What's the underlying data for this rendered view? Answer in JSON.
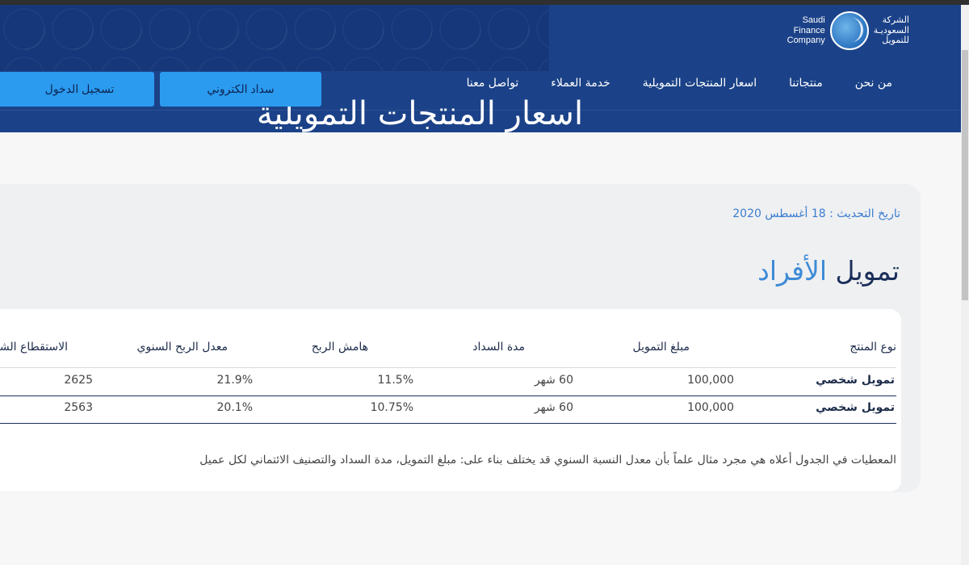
{
  "logo": {
    "en_lines": [
      "Saudi",
      "Finance",
      "Company"
    ],
    "ar_lines": [
      "الشركة",
      "السعوديـة",
      "للتمويل"
    ]
  },
  "nav": {
    "items": [
      "من نحن",
      "منتجاتنا",
      "اسعار المنتجات التمويلية",
      "خدمة العملاء",
      "تواصل معنا"
    ]
  },
  "buttons": {
    "pay": "سداد الكتروني",
    "login": "تسجيل الدخول"
  },
  "hero": {
    "title_behind": "اسعار المنتجات التمويلية"
  },
  "page": {
    "update_date": "تاريخ التحديث : 18 أغسطس 2020",
    "section_title_part1": "تمويل",
    "section_title_part2": "الأفراد"
  },
  "table": {
    "headers": [
      "نوع المنتج",
      "مبلغ التمويل",
      "مدة السداد",
      "هامش الربح",
      "معدل الربح السنوي",
      "الاستقطاع الشهري"
    ],
    "rows": [
      [
        "تمويل شخصي",
        "100,000",
        "60 شهر",
        "11.5%",
        "21.9%",
        "2625"
      ],
      [
        "تمويل شخصي",
        "100,000",
        "60 شهر",
        "10.75%",
        "20.1%",
        "2563"
      ]
    ]
  },
  "note": "المعطيات في الجدول أعلاه هي مجرد مثال علماً بأن معدل النسبة السنوي قد يختلف بناء على: مبلغ التمويل، مدة السداد والتصنيف الائتماني لكل عميل",
  "colors": {
    "header_bg": "#1b4288",
    "button_bg": "#2b9bf0",
    "accent_blue": "#3d8bd6",
    "title_dark": "#1b2f5a"
  }
}
